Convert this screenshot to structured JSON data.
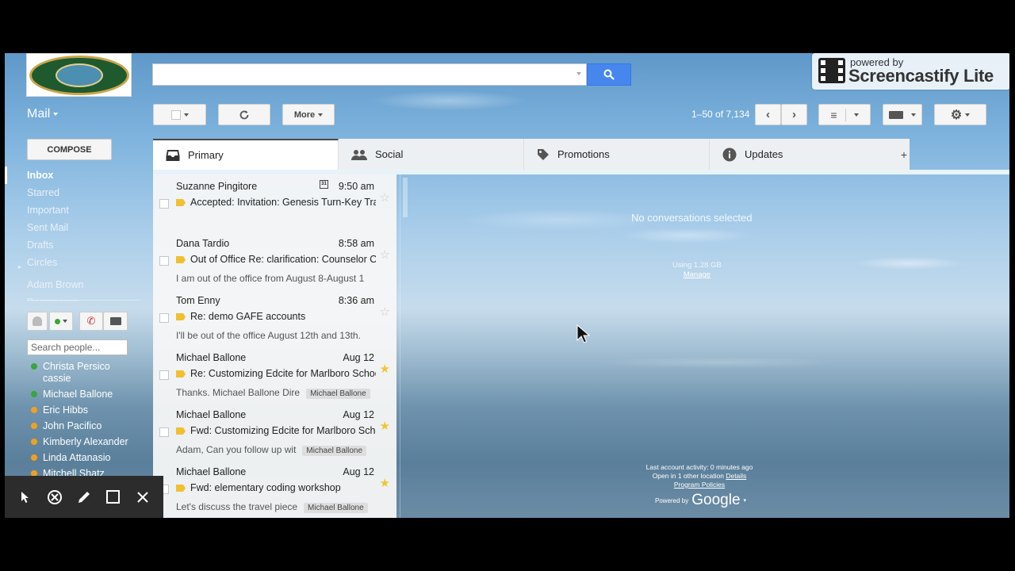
{
  "search": {
    "placeholder": "",
    "value": ""
  },
  "watermark": {
    "powered_by": "powered by",
    "brand": "Screencastify Lite"
  },
  "header": {
    "mail_label": "Mail"
  },
  "toolbar": {
    "more_label": "More",
    "pager": "1–50 of 7,134"
  },
  "sidebar": {
    "compose_label": "COMPOSE",
    "nav_items": [
      "Inbox",
      "Starred",
      "Important",
      "Sent Mail",
      "Drafts",
      "Circles",
      "Adam Brown",
      "Bacomessa"
    ],
    "people_search_placeholder": "Search people...",
    "contacts": [
      {
        "name": "Christa Persico",
        "sub": "cassie",
        "status_color": "#3aa53a"
      },
      {
        "name": "Michael Ballone",
        "sub": "",
        "status_color": "#3aa53a"
      },
      {
        "name": "Eric Hibbs",
        "sub": "",
        "status_color": "#f0a020"
      },
      {
        "name": "John Pacifico",
        "sub": "",
        "status_color": "#f0a020"
      },
      {
        "name": "Kimberly Alexander",
        "sub": "",
        "status_color": "#f0a020"
      },
      {
        "name": "Linda Attanasio",
        "sub": "",
        "status_color": "#f0a020"
      },
      {
        "name": "Mitchell Shatz",
        "sub": "",
        "status_color": "#f0a020"
      }
    ]
  },
  "tabs": [
    {
      "label": "Primary",
      "icon": "inbox-icon"
    },
    {
      "label": "Social",
      "icon": "people-icon"
    },
    {
      "label": "Promotions",
      "icon": "tag-icon"
    },
    {
      "label": "Updates",
      "icon": "info-icon"
    }
  ],
  "tab_add": "+",
  "messages": [
    {
      "sender": "Suzanne Pingitore",
      "time": "9:50 am",
      "calendar": true,
      "subject": "Accepted: Invitation: Genesis Turn-Key Trai",
      "snippet": "",
      "label": "",
      "starred": false
    },
    {
      "sender": "Dana Tardio",
      "time": "8:58 am",
      "calendar": false,
      "subject": "Out of Office Re: clarification: Counselor Ob",
      "snippet": "I am out of the office from August 8-August 1",
      "label": "",
      "starred": false
    },
    {
      "sender": "Tom Enny",
      "time": "8:36 am",
      "calendar": false,
      "subject": "Re: demo GAFE accounts",
      "snippet": "I'll be out of the office August 12th and 13th.",
      "label": "",
      "starred": false
    },
    {
      "sender": "Michael Ballone",
      "time": "Aug 12",
      "calendar": false,
      "subject": "Re: Customizing Edcite for Marlboro Schoo",
      "snippet": "Thanks. Michael Ballone Dire",
      "label": "Michael Ballone",
      "starred": true
    },
    {
      "sender": "Michael Ballone",
      "time": "Aug 12",
      "calendar": false,
      "subject": "Fwd: Customizing Edcite for Marlboro Scho",
      "snippet": "Adam, Can you follow up wit",
      "label": "Michael Ballone",
      "starred": true
    },
    {
      "sender": "Michael Ballone",
      "time": "Aug 12",
      "calendar": false,
      "subject": "Fwd: elementary coding workshop",
      "snippet": "Let's discuss the travel piece",
      "label": "Michael Ballone",
      "starred": true
    }
  ],
  "preview": {
    "no_conversations": "No conversations selected",
    "usage": "Using 1.28 GB",
    "manage": "Manage",
    "last_activity": "Last account activity: 0 minutes ago",
    "open_in": "Open in 1 other location",
    "details": "Details",
    "program_policies": "Program Policies",
    "powered_by": "Powered by",
    "google": "Google"
  }
}
